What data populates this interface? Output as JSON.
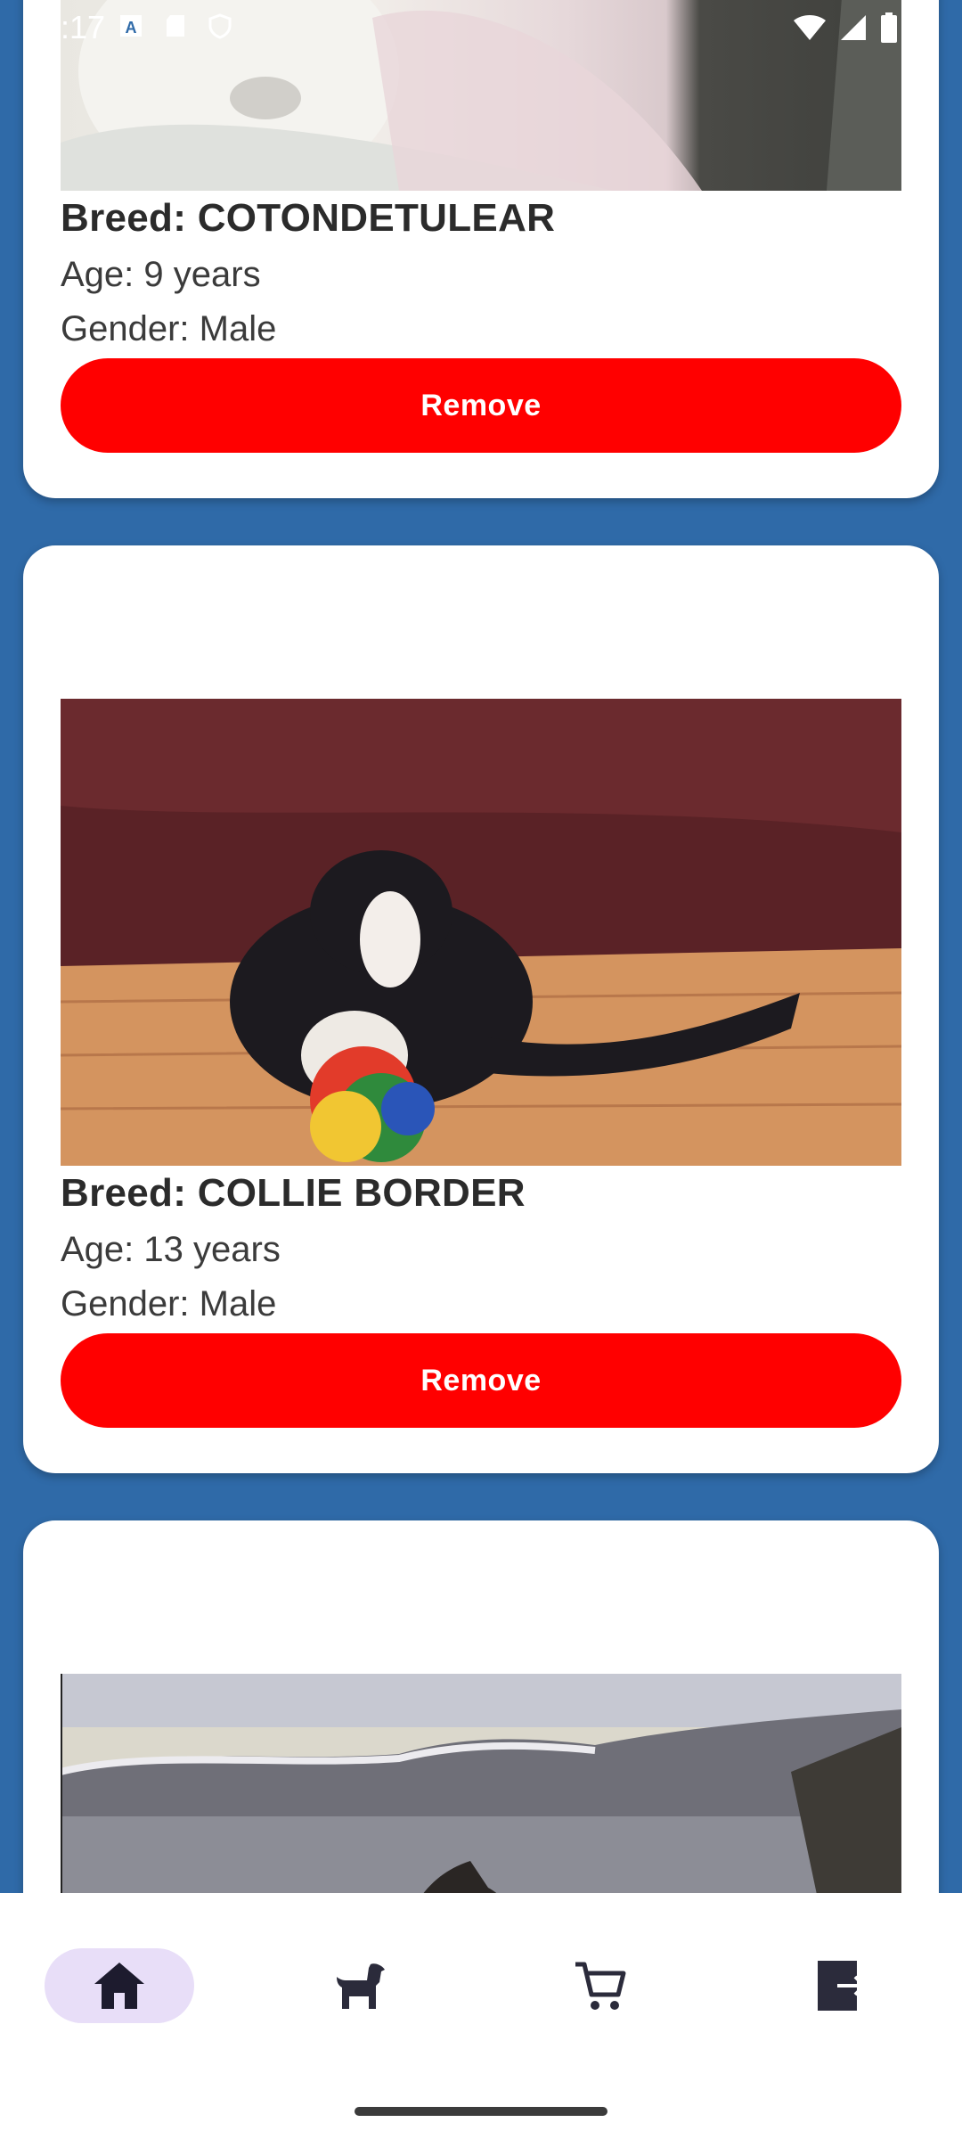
{
  "status_bar": {
    "time": ":17",
    "left_icons": [
      "text-a-icon",
      "sd-card-icon",
      "shield-icon"
    ],
    "right_icons": [
      "wifi-icon",
      "signal-icon",
      "battery-icon"
    ]
  },
  "dogs": [
    {
      "breed": "Breed: COTONDETULEAR",
      "age": "Age: 9 years",
      "gender": "Gender: Male",
      "remove_label": "Remove"
    },
    {
      "breed": "Breed: COLLIE BORDER",
      "age": "Age: 13 years",
      "gender": "Gender: Male",
      "remove_label": "Remove"
    },
    {
      "breed": "",
      "age": "",
      "gender": "",
      "remove_label": ""
    }
  ],
  "bottom_nav": {
    "items": [
      {
        "icon": "home-icon",
        "active": true
      },
      {
        "icon": "dog-icon",
        "active": false
      },
      {
        "icon": "cart-icon",
        "active": false
      },
      {
        "icon": "logout-icon",
        "active": false
      }
    ]
  },
  "colors": {
    "background": "#2f6aa8",
    "remove_button": "#ff0000",
    "nav_active": "#e8def8",
    "icon": "#2b2b3b"
  }
}
